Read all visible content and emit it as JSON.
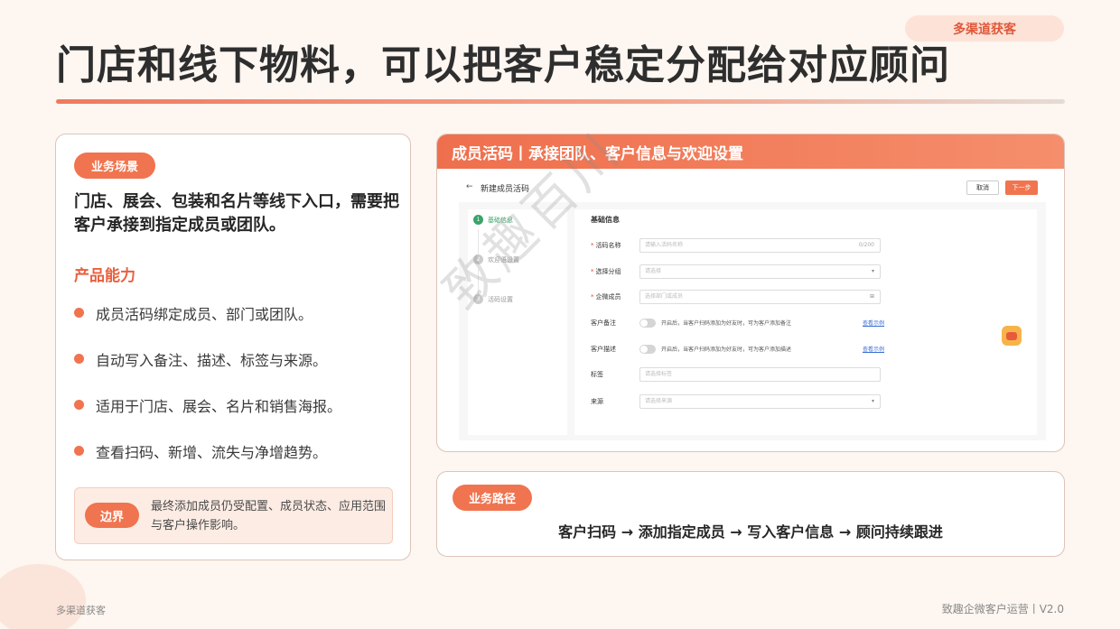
{
  "header": {
    "tag": "多渠道获客",
    "title": "门店和线下物料，可以把客户稳定分配给对应顾问"
  },
  "left_card": {
    "scene_badge": "业务场景",
    "scene_text": "门店、展会、包装和名片等线下入口，需要把客户承接到指定成员或团队。",
    "capability_title": "产品能力",
    "capabilities": [
      "成员活码绑定成员、部门或团队。",
      "自动写入备注、描述、标签与来源。",
      "适用于门店、展会、名片和销售海报。",
      "查看扫码、新增、流失与净增趋势。"
    ],
    "limit_badge": "边界",
    "limit_text": "最终添加成员仍受配置、成员状态、应用范围与客户操作影响。"
  },
  "right_card": {
    "header": "成员活码丨承接团队、客户信息与欢迎设置",
    "screenshot": {
      "title": "新建成员活码",
      "cancel": "取消",
      "next": "下一步",
      "steps": [
        "基础信息",
        "欢迎语设置",
        "活码设置"
      ],
      "section": "基础信息",
      "fields": {
        "name_label": "活码名称",
        "name_placeholder": "请输入活码名称",
        "name_counter": "0/200",
        "group_label": "选择分组",
        "group_placeholder": "请选择",
        "member_label": "企微成员",
        "member_placeholder": "选择部门或成员",
        "remark_label": "客户备注",
        "remark_text": "开启后，当客户扫码添加为好友时，可为客户添加备注",
        "remark_link": "查看示例",
        "desc_label": "客户描述",
        "desc_text": "开启后，当客户扫码添加为好友时，可为客户添加描述",
        "desc_link": "查看示例",
        "tag_label": "标签",
        "tag_placeholder": "请选择标签",
        "source_label": "来源",
        "source_placeholder": "请选择来源"
      }
    },
    "watermark": "致趣百川"
  },
  "path_card": {
    "badge": "业务路径",
    "text": "客户扫码 → 添加指定成员 → 写入客户信息 → 顾问持续跟进"
  },
  "footer": {
    "left": "多渠道获客",
    "right": "致趣企微客户运营丨V2.0"
  }
}
